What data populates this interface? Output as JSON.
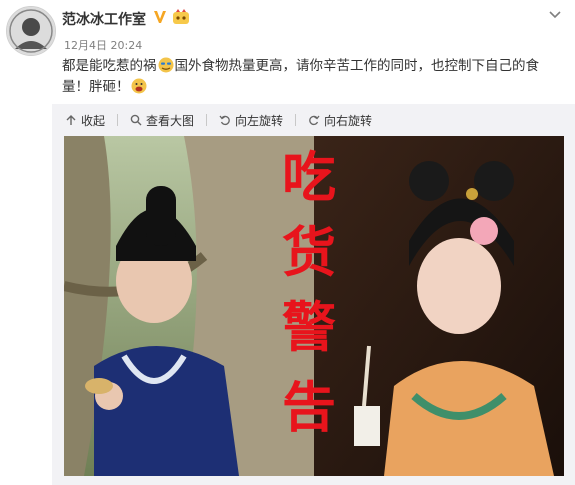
{
  "post": {
    "author": "范冰冰工作室",
    "timestamp": "12月4日 20:24",
    "text_part1": "都是能吃惹的祸",
    "text_part2": "国外食物热量更高，请你辛苦工作的同时，也控制下自己的食量！胖砸！",
    "emoji1": "doge-face-emoji",
    "emoji2": "chomp-face-emoji"
  },
  "toolbar": {
    "collapse": "收起",
    "view_large": "查看大图",
    "rotate_left": "向左旋转",
    "rotate_right": "向右旋转"
  },
  "image": {
    "overlay_chars": [
      "吃",
      "货",
      "警",
      "告"
    ]
  },
  "colors": {
    "verified": "#f5a623",
    "overlay_text": "#e8141c",
    "link": "#333333"
  }
}
